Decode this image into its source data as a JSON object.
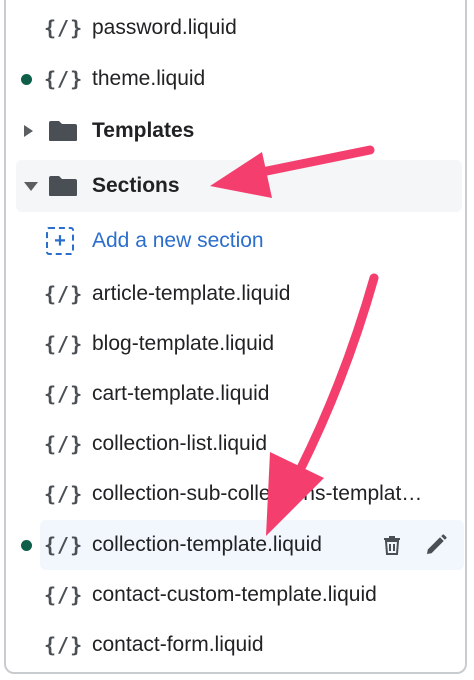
{
  "tree": {
    "items": [
      {
        "type": "file",
        "label": "password.liquid",
        "modified": false
      },
      {
        "type": "file",
        "label": "theme.liquid",
        "modified": true
      },
      {
        "type": "folder",
        "label": "Templates",
        "expanded": false
      },
      {
        "type": "folder",
        "label": "Sections",
        "expanded": true
      },
      {
        "type": "add",
        "label": "Add a new section"
      },
      {
        "type": "file",
        "label": "article-template.liquid",
        "modified": false
      },
      {
        "type": "file",
        "label": "blog-template.liquid",
        "modified": false
      },
      {
        "type": "file",
        "label": "cart-template.liquid",
        "modified": false
      },
      {
        "type": "file",
        "label": "collection-list.liquid",
        "modified": false
      },
      {
        "type": "file",
        "label": "collection-sub-collections-templat…",
        "modified": false
      },
      {
        "type": "file",
        "label": "collection-template.liquid",
        "modified": true,
        "active": true
      },
      {
        "type": "file",
        "label": "contact-custom-template.liquid",
        "modified": false
      },
      {
        "type": "file",
        "label": "contact-form.liquid",
        "modified": false
      }
    ],
    "file_icon_text": "{/}",
    "add_icon_text": "+"
  },
  "colors": {
    "accent": "#2c6ecb",
    "modified_dot": "#0f5e4a",
    "arrow": "#f43f6e",
    "text": "#202223"
  },
  "icons": {
    "file": "code-braces-icon",
    "folder": "folder-icon",
    "add": "add-section-icon",
    "delete": "trash-icon",
    "edit": "pencil-icon"
  }
}
